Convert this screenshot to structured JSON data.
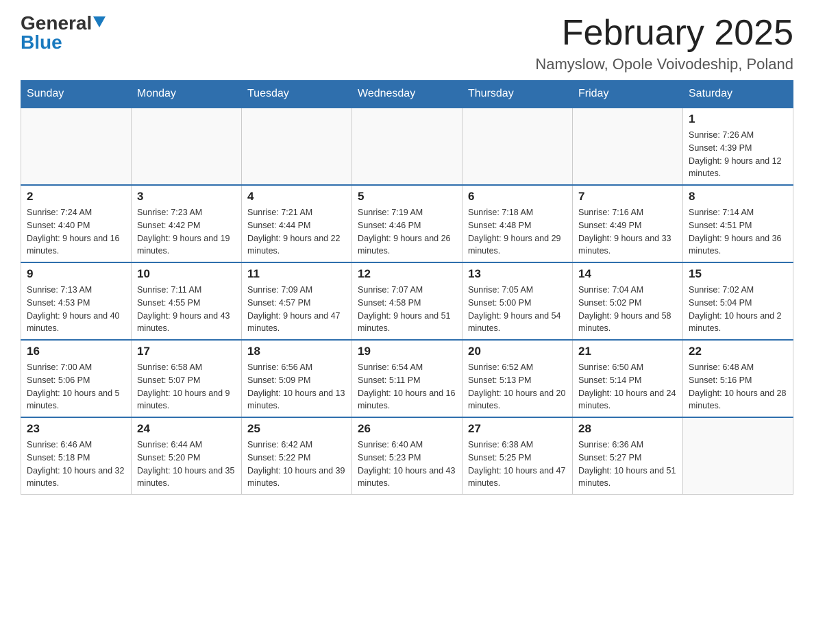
{
  "header": {
    "logo_general": "General",
    "logo_blue": "Blue",
    "month_title": "February 2025",
    "location": "Namyslow, Opole Voivodeship, Poland"
  },
  "weekdays": [
    "Sunday",
    "Monday",
    "Tuesday",
    "Wednesday",
    "Thursday",
    "Friday",
    "Saturday"
  ],
  "weeks": [
    [
      {
        "day": "",
        "info": ""
      },
      {
        "day": "",
        "info": ""
      },
      {
        "day": "",
        "info": ""
      },
      {
        "day": "",
        "info": ""
      },
      {
        "day": "",
        "info": ""
      },
      {
        "day": "",
        "info": ""
      },
      {
        "day": "1",
        "info": "Sunrise: 7:26 AM\nSunset: 4:39 PM\nDaylight: 9 hours and 12 minutes."
      }
    ],
    [
      {
        "day": "2",
        "info": "Sunrise: 7:24 AM\nSunset: 4:40 PM\nDaylight: 9 hours and 16 minutes."
      },
      {
        "day": "3",
        "info": "Sunrise: 7:23 AM\nSunset: 4:42 PM\nDaylight: 9 hours and 19 minutes."
      },
      {
        "day": "4",
        "info": "Sunrise: 7:21 AM\nSunset: 4:44 PM\nDaylight: 9 hours and 22 minutes."
      },
      {
        "day": "5",
        "info": "Sunrise: 7:19 AM\nSunset: 4:46 PM\nDaylight: 9 hours and 26 minutes."
      },
      {
        "day": "6",
        "info": "Sunrise: 7:18 AM\nSunset: 4:48 PM\nDaylight: 9 hours and 29 minutes."
      },
      {
        "day": "7",
        "info": "Sunrise: 7:16 AM\nSunset: 4:49 PM\nDaylight: 9 hours and 33 minutes."
      },
      {
        "day": "8",
        "info": "Sunrise: 7:14 AM\nSunset: 4:51 PM\nDaylight: 9 hours and 36 minutes."
      }
    ],
    [
      {
        "day": "9",
        "info": "Sunrise: 7:13 AM\nSunset: 4:53 PM\nDaylight: 9 hours and 40 minutes."
      },
      {
        "day": "10",
        "info": "Sunrise: 7:11 AM\nSunset: 4:55 PM\nDaylight: 9 hours and 43 minutes."
      },
      {
        "day": "11",
        "info": "Sunrise: 7:09 AM\nSunset: 4:57 PM\nDaylight: 9 hours and 47 minutes."
      },
      {
        "day": "12",
        "info": "Sunrise: 7:07 AM\nSunset: 4:58 PM\nDaylight: 9 hours and 51 minutes."
      },
      {
        "day": "13",
        "info": "Sunrise: 7:05 AM\nSunset: 5:00 PM\nDaylight: 9 hours and 54 minutes."
      },
      {
        "day": "14",
        "info": "Sunrise: 7:04 AM\nSunset: 5:02 PM\nDaylight: 9 hours and 58 minutes."
      },
      {
        "day": "15",
        "info": "Sunrise: 7:02 AM\nSunset: 5:04 PM\nDaylight: 10 hours and 2 minutes."
      }
    ],
    [
      {
        "day": "16",
        "info": "Sunrise: 7:00 AM\nSunset: 5:06 PM\nDaylight: 10 hours and 5 minutes."
      },
      {
        "day": "17",
        "info": "Sunrise: 6:58 AM\nSunset: 5:07 PM\nDaylight: 10 hours and 9 minutes."
      },
      {
        "day": "18",
        "info": "Sunrise: 6:56 AM\nSunset: 5:09 PM\nDaylight: 10 hours and 13 minutes."
      },
      {
        "day": "19",
        "info": "Sunrise: 6:54 AM\nSunset: 5:11 PM\nDaylight: 10 hours and 16 minutes."
      },
      {
        "day": "20",
        "info": "Sunrise: 6:52 AM\nSunset: 5:13 PM\nDaylight: 10 hours and 20 minutes."
      },
      {
        "day": "21",
        "info": "Sunrise: 6:50 AM\nSunset: 5:14 PM\nDaylight: 10 hours and 24 minutes."
      },
      {
        "day": "22",
        "info": "Sunrise: 6:48 AM\nSunset: 5:16 PM\nDaylight: 10 hours and 28 minutes."
      }
    ],
    [
      {
        "day": "23",
        "info": "Sunrise: 6:46 AM\nSunset: 5:18 PM\nDaylight: 10 hours and 32 minutes."
      },
      {
        "day": "24",
        "info": "Sunrise: 6:44 AM\nSunset: 5:20 PM\nDaylight: 10 hours and 35 minutes."
      },
      {
        "day": "25",
        "info": "Sunrise: 6:42 AM\nSunset: 5:22 PM\nDaylight: 10 hours and 39 minutes."
      },
      {
        "day": "26",
        "info": "Sunrise: 6:40 AM\nSunset: 5:23 PM\nDaylight: 10 hours and 43 minutes."
      },
      {
        "day": "27",
        "info": "Sunrise: 6:38 AM\nSunset: 5:25 PM\nDaylight: 10 hours and 47 minutes."
      },
      {
        "day": "28",
        "info": "Sunrise: 6:36 AM\nSunset: 5:27 PM\nDaylight: 10 hours and 51 minutes."
      },
      {
        "day": "",
        "info": ""
      }
    ]
  ]
}
